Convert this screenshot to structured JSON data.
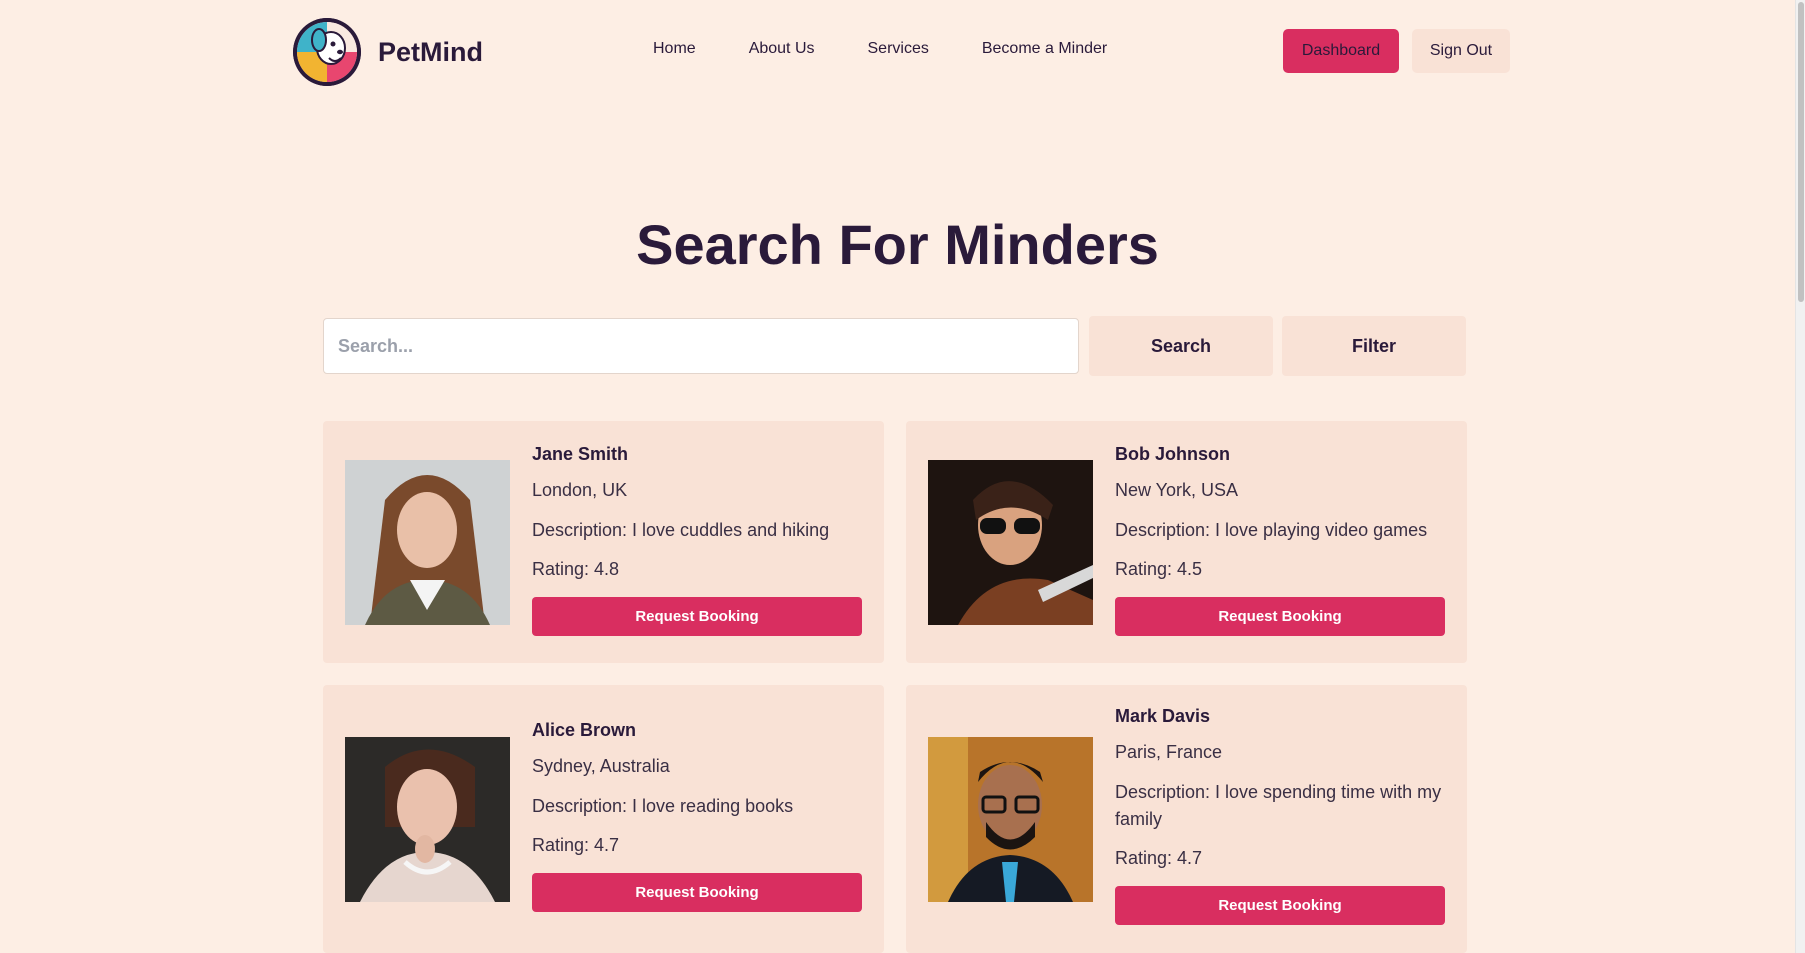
{
  "brand": {
    "name": "PetMind",
    "logo_icon": "dog-logo-icon"
  },
  "nav": {
    "items": [
      {
        "label": "Home"
      },
      {
        "label": "About Us"
      },
      {
        "label": "Services"
      },
      {
        "label": "Become a Minder"
      }
    ],
    "dashboard_label": "Dashboard",
    "signout_label": "Sign Out"
  },
  "main": {
    "title": "Search For Minders",
    "search": {
      "placeholder": "Search...",
      "value": ""
    },
    "search_button": "Search",
    "filter_button": "Filter"
  },
  "minders": [
    {
      "name": "Jane Smith",
      "location": "London, UK",
      "description": "Description: I love cuddles and hiking",
      "rating": "Rating: 4.8",
      "action": "Request Booking"
    },
    {
      "name": "Bob Johnson",
      "location": "New York, USA",
      "description": "Description: I love playing video games",
      "rating": "Rating: 4.5",
      "action": "Request Booking"
    },
    {
      "name": "Alice Brown",
      "location": "Sydney, Australia",
      "description": "Description: I love reading books",
      "rating": "Rating: 4.7",
      "action": "Request Booking"
    },
    {
      "name": "Mark Davis",
      "location": "Paris, France",
      "description": "Description: I love spending time with my family",
      "rating": "Rating: 4.7",
      "action": "Request Booking"
    }
  ],
  "colors": {
    "background": "#fdeee4",
    "card": "#f9e2d6",
    "accent": "#d92e60",
    "text": "#2a1a3a"
  }
}
